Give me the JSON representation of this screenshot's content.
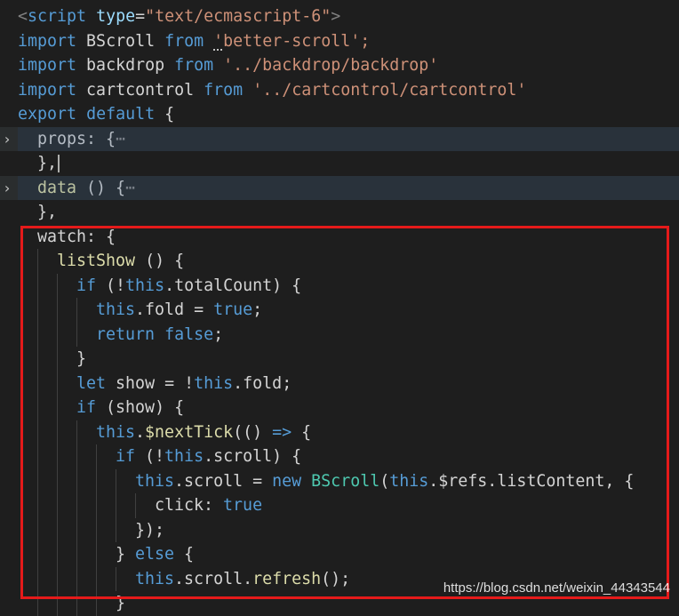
{
  "editor": {
    "lines": [
      {
        "indent": 0,
        "tokens": [
          [
            "punc",
            "<"
          ],
          [
            "tag",
            "script"
          ],
          [
            "plain",
            " "
          ],
          [
            "attr",
            "type"
          ],
          [
            "plain",
            "="
          ],
          [
            "str",
            "\"text/ecmascript-6\""
          ],
          [
            "punc",
            ">"
          ]
        ]
      },
      {
        "indent": 0,
        "tokens": [
          [
            "kw",
            "import"
          ],
          [
            "plain",
            " BScroll "
          ],
          [
            "kw",
            "from"
          ],
          [
            "plain",
            " "
          ],
          [
            "str-sq",
            "'"
          ],
          [
            "str",
            "better-scroll';"
          ]
        ]
      },
      {
        "indent": 0,
        "tokens": [
          [
            "kw",
            "import"
          ],
          [
            "plain",
            " backdrop "
          ],
          [
            "kw",
            "from"
          ],
          [
            "plain",
            " "
          ],
          [
            "str",
            "'../backdrop/backdrop'"
          ]
        ]
      },
      {
        "indent": 0,
        "tokens": [
          [
            "kw",
            "import"
          ],
          [
            "plain",
            " cartcontrol "
          ],
          [
            "kw",
            "from"
          ],
          [
            "plain",
            " "
          ],
          [
            "str",
            "'../cartcontrol/cartcontrol'"
          ]
        ]
      },
      {
        "indent": 0,
        "tokens": [
          [
            "kw",
            "export"
          ],
          [
            "plain",
            " "
          ],
          [
            "kw",
            "default"
          ],
          [
            "plain",
            " {"
          ]
        ]
      },
      {
        "indent": 1,
        "folded": true,
        "tokens": [
          [
            "prop",
            "props"
          ],
          [
            "plain",
            ": {"
          ],
          [
            "ellipsis",
            "⋯"
          ]
        ]
      },
      {
        "indent": 1,
        "cursor": true,
        "tokens": [
          [
            "plain",
            "},"
          ]
        ]
      },
      {
        "indent": 1,
        "folded": true,
        "tokens": [
          [
            "fn",
            "data"
          ],
          [
            "plain",
            " () {"
          ],
          [
            "ellipsis",
            "⋯"
          ]
        ]
      },
      {
        "indent": 1,
        "tokens": [
          [
            "plain",
            "},"
          ]
        ]
      },
      {
        "indent": 1,
        "tokens": [
          [
            "prop",
            "watch"
          ],
          [
            "plain",
            ": {"
          ]
        ]
      },
      {
        "indent": 2,
        "tokens": [
          [
            "fn",
            "listShow"
          ],
          [
            "plain",
            " () {"
          ]
        ]
      },
      {
        "indent": 3,
        "tokens": [
          [
            "ctl",
            "if"
          ],
          [
            "plain",
            " (!"
          ],
          [
            "kw",
            "this"
          ],
          [
            "plain",
            "."
          ],
          [
            "prop",
            "totalCount"
          ],
          [
            "plain",
            ") {"
          ]
        ]
      },
      {
        "indent": 4,
        "tokens": [
          [
            "kw",
            "this"
          ],
          [
            "plain",
            "."
          ],
          [
            "prop",
            "fold"
          ],
          [
            "plain",
            " = "
          ],
          [
            "kw",
            "true"
          ],
          [
            "plain",
            ";"
          ]
        ]
      },
      {
        "indent": 4,
        "tokens": [
          [
            "ctl",
            "return"
          ],
          [
            "plain",
            " "
          ],
          [
            "kw",
            "false"
          ],
          [
            "plain",
            ";"
          ]
        ]
      },
      {
        "indent": 3,
        "tokens": [
          [
            "plain",
            "}"
          ]
        ]
      },
      {
        "indent": 3,
        "tokens": [
          [
            "kw",
            "let"
          ],
          [
            "plain",
            " "
          ],
          [
            "var",
            "show"
          ],
          [
            "plain",
            " = !"
          ],
          [
            "kw",
            "this"
          ],
          [
            "plain",
            "."
          ],
          [
            "prop",
            "fold"
          ],
          [
            "plain",
            ";"
          ]
        ]
      },
      {
        "indent": 3,
        "tokens": [
          [
            "ctl",
            "if"
          ],
          [
            "plain",
            " ("
          ],
          [
            "var",
            "show"
          ],
          [
            "plain",
            ") {"
          ]
        ]
      },
      {
        "indent": 4,
        "tokens": [
          [
            "kw",
            "this"
          ],
          [
            "plain",
            "."
          ],
          [
            "fn",
            "$nextTick"
          ],
          [
            "plain",
            "(() "
          ],
          [
            "kw",
            "=>"
          ],
          [
            "plain",
            " {"
          ]
        ]
      },
      {
        "indent": 5,
        "tokens": [
          [
            "ctl",
            "if"
          ],
          [
            "plain",
            " (!"
          ],
          [
            "kw",
            "this"
          ],
          [
            "plain",
            "."
          ],
          [
            "prop",
            "scroll"
          ],
          [
            "plain",
            ") {"
          ]
        ]
      },
      {
        "indent": 6,
        "tokens": [
          [
            "kw",
            "this"
          ],
          [
            "plain",
            "."
          ],
          [
            "prop",
            "scroll"
          ],
          [
            "plain",
            " = "
          ],
          [
            "kw",
            "new"
          ],
          [
            "plain",
            " "
          ],
          [
            "class",
            "BScroll"
          ],
          [
            "plain",
            "("
          ],
          [
            "kw",
            "this"
          ],
          [
            "plain",
            ".$refs."
          ],
          [
            "prop",
            "listContent"
          ],
          [
            "plain",
            ", {"
          ]
        ]
      },
      {
        "indent": 7,
        "tokens": [
          [
            "prop",
            "click"
          ],
          [
            "plain",
            ": "
          ],
          [
            "kw",
            "true"
          ]
        ]
      },
      {
        "indent": 6,
        "tokens": [
          [
            "plain",
            "});"
          ]
        ]
      },
      {
        "indent": 5,
        "tokens": [
          [
            "plain",
            "} "
          ],
          [
            "ctl",
            "else"
          ],
          [
            "plain",
            " {"
          ]
        ]
      },
      {
        "indent": 6,
        "tokens": [
          [
            "kw",
            "this"
          ],
          [
            "plain",
            "."
          ],
          [
            "prop",
            "scroll"
          ],
          [
            "plain",
            "."
          ],
          [
            "fn",
            "refresh"
          ],
          [
            "plain",
            "();"
          ]
        ]
      },
      {
        "indent": 5,
        "tokens": [
          [
            "plain",
            "}"
          ]
        ]
      }
    ]
  },
  "colors": {
    "highlight_box": "#e51a1a",
    "background": "#1e1e1e"
  },
  "icons": {
    "fold_arrow": "chevron-right-icon"
  },
  "fold_arrow_glyph": "›",
  "watermark": "https://blog.csdn.net/weixin_44343544"
}
